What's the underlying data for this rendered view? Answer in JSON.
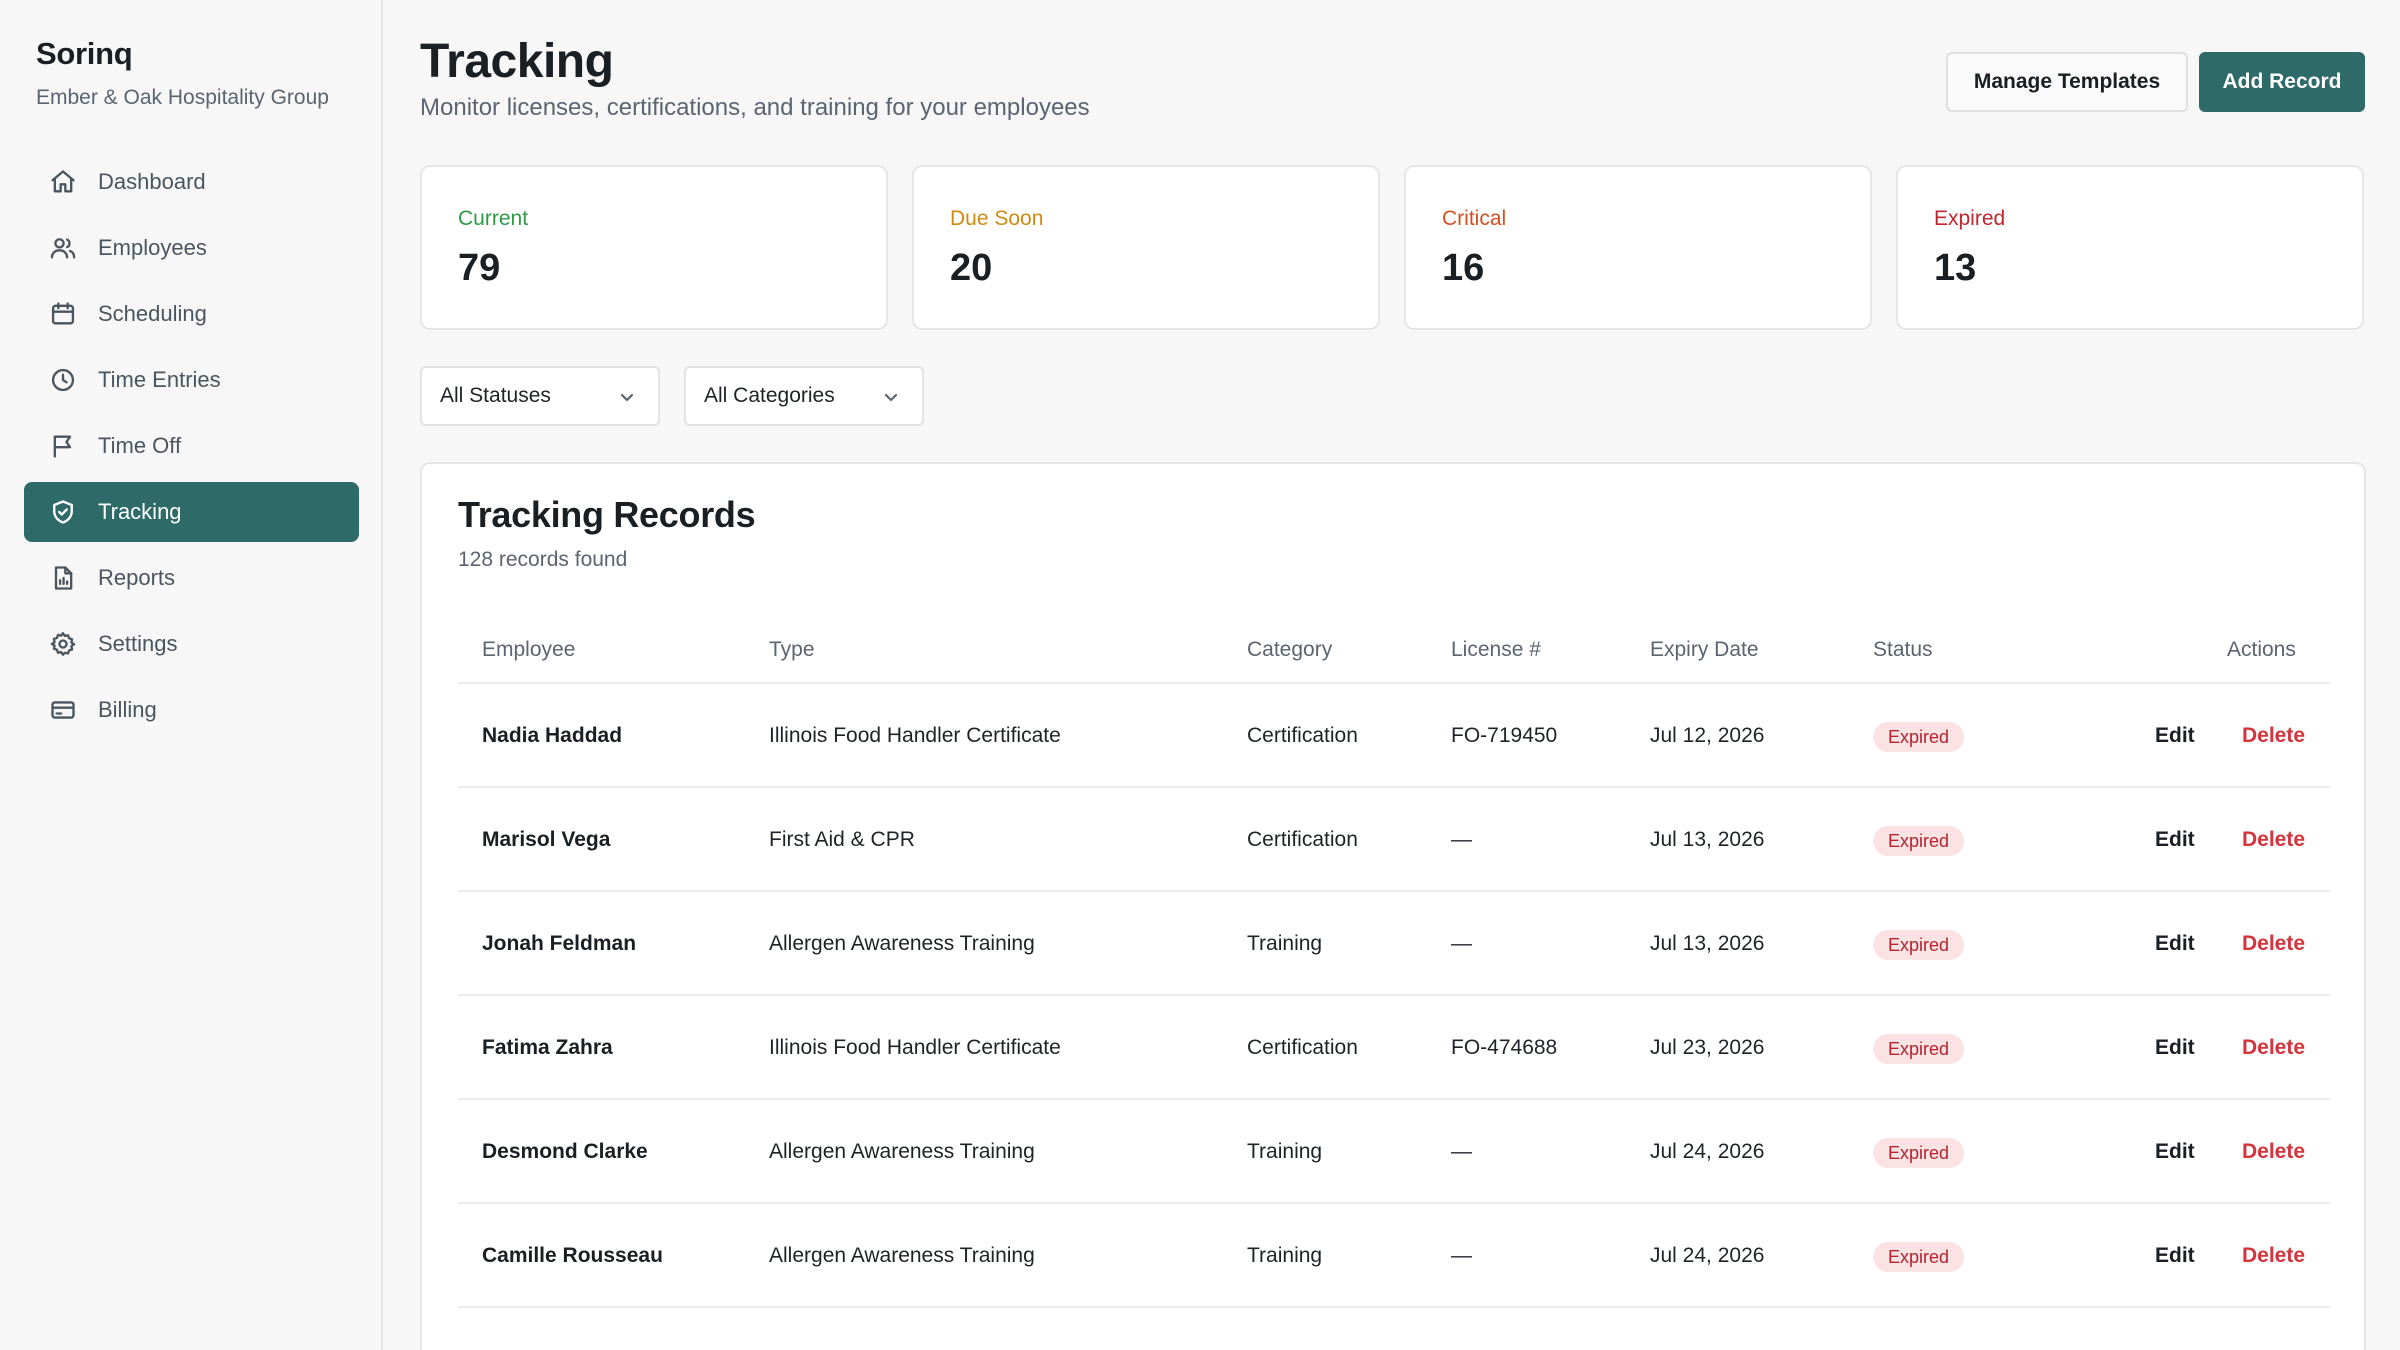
{
  "sidebar": {
    "brand": "Sorinq",
    "org": "Ember & Oak Hospitality Group",
    "items": [
      {
        "label": "Dashboard",
        "icon": "home-icon"
      },
      {
        "label": "Employees",
        "icon": "users-icon"
      },
      {
        "label": "Scheduling",
        "icon": "calendar-icon"
      },
      {
        "label": "Time Entries",
        "icon": "clock-icon"
      },
      {
        "label": "Time Off",
        "icon": "flag-icon"
      },
      {
        "label": "Tracking",
        "icon": "shield-check-icon",
        "active": true
      },
      {
        "label": "Reports",
        "icon": "report-icon"
      },
      {
        "label": "Settings",
        "icon": "gear-icon"
      },
      {
        "label": "Billing",
        "icon": "credit-card-icon"
      }
    ]
  },
  "header": {
    "title": "Tracking",
    "subtitle": "Monitor licenses, certifications, and training for your employees",
    "manage_label": "Manage Templates",
    "add_label": "Add Record"
  },
  "stats": [
    {
      "label": "Current",
      "value": "79",
      "color": "#2f9a45"
    },
    {
      "label": "Due Soon",
      "value": "20",
      "color": "#d08a12"
    },
    {
      "label": "Critical",
      "value": "16",
      "color": "#d3501f"
    },
    {
      "label": "Expired",
      "value": "13",
      "color": "#c0262d"
    }
  ],
  "filters": {
    "status": "All Statuses",
    "category": "All Categories"
  },
  "records": {
    "title": "Tracking Records",
    "count_text": "128 records found",
    "columns": {
      "employee": "Employee",
      "type": "Type",
      "category": "Category",
      "license": "License #",
      "expiry": "Expiry Date",
      "status": "Status",
      "actions": "Actions"
    },
    "edit_label": "Edit",
    "delete_label": "Delete",
    "rows": [
      {
        "employee": "Nadia Haddad",
        "type": "Illinois Food Handler Certificate",
        "category": "Certification",
        "license": "FO-719450",
        "expiry": "Jul 12, 2026",
        "status": "Expired"
      },
      {
        "employee": "Marisol Vega",
        "type": "First Aid & CPR",
        "category": "Certification",
        "license": "—",
        "expiry": "Jul 13, 2026",
        "status": "Expired"
      },
      {
        "employee": "Jonah Feldman",
        "type": "Allergen Awareness Training",
        "category": "Training",
        "license": "—",
        "expiry": "Jul 13, 2026",
        "status": "Expired"
      },
      {
        "employee": "Fatima Zahra",
        "type": "Illinois Food Handler Certificate",
        "category": "Certification",
        "license": "FO-474688",
        "expiry": "Jul 23, 2026",
        "status": "Expired"
      },
      {
        "employee": "Desmond Clarke",
        "type": "Allergen Awareness Training",
        "category": "Training",
        "license": "—",
        "expiry": "Jul 24, 2026",
        "status": "Expired"
      },
      {
        "employee": "Camille Rousseau",
        "type": "Allergen Awareness Training",
        "category": "Training",
        "license": "—",
        "expiry": "Jul 24, 2026",
        "status": "Expired"
      }
    ]
  }
}
